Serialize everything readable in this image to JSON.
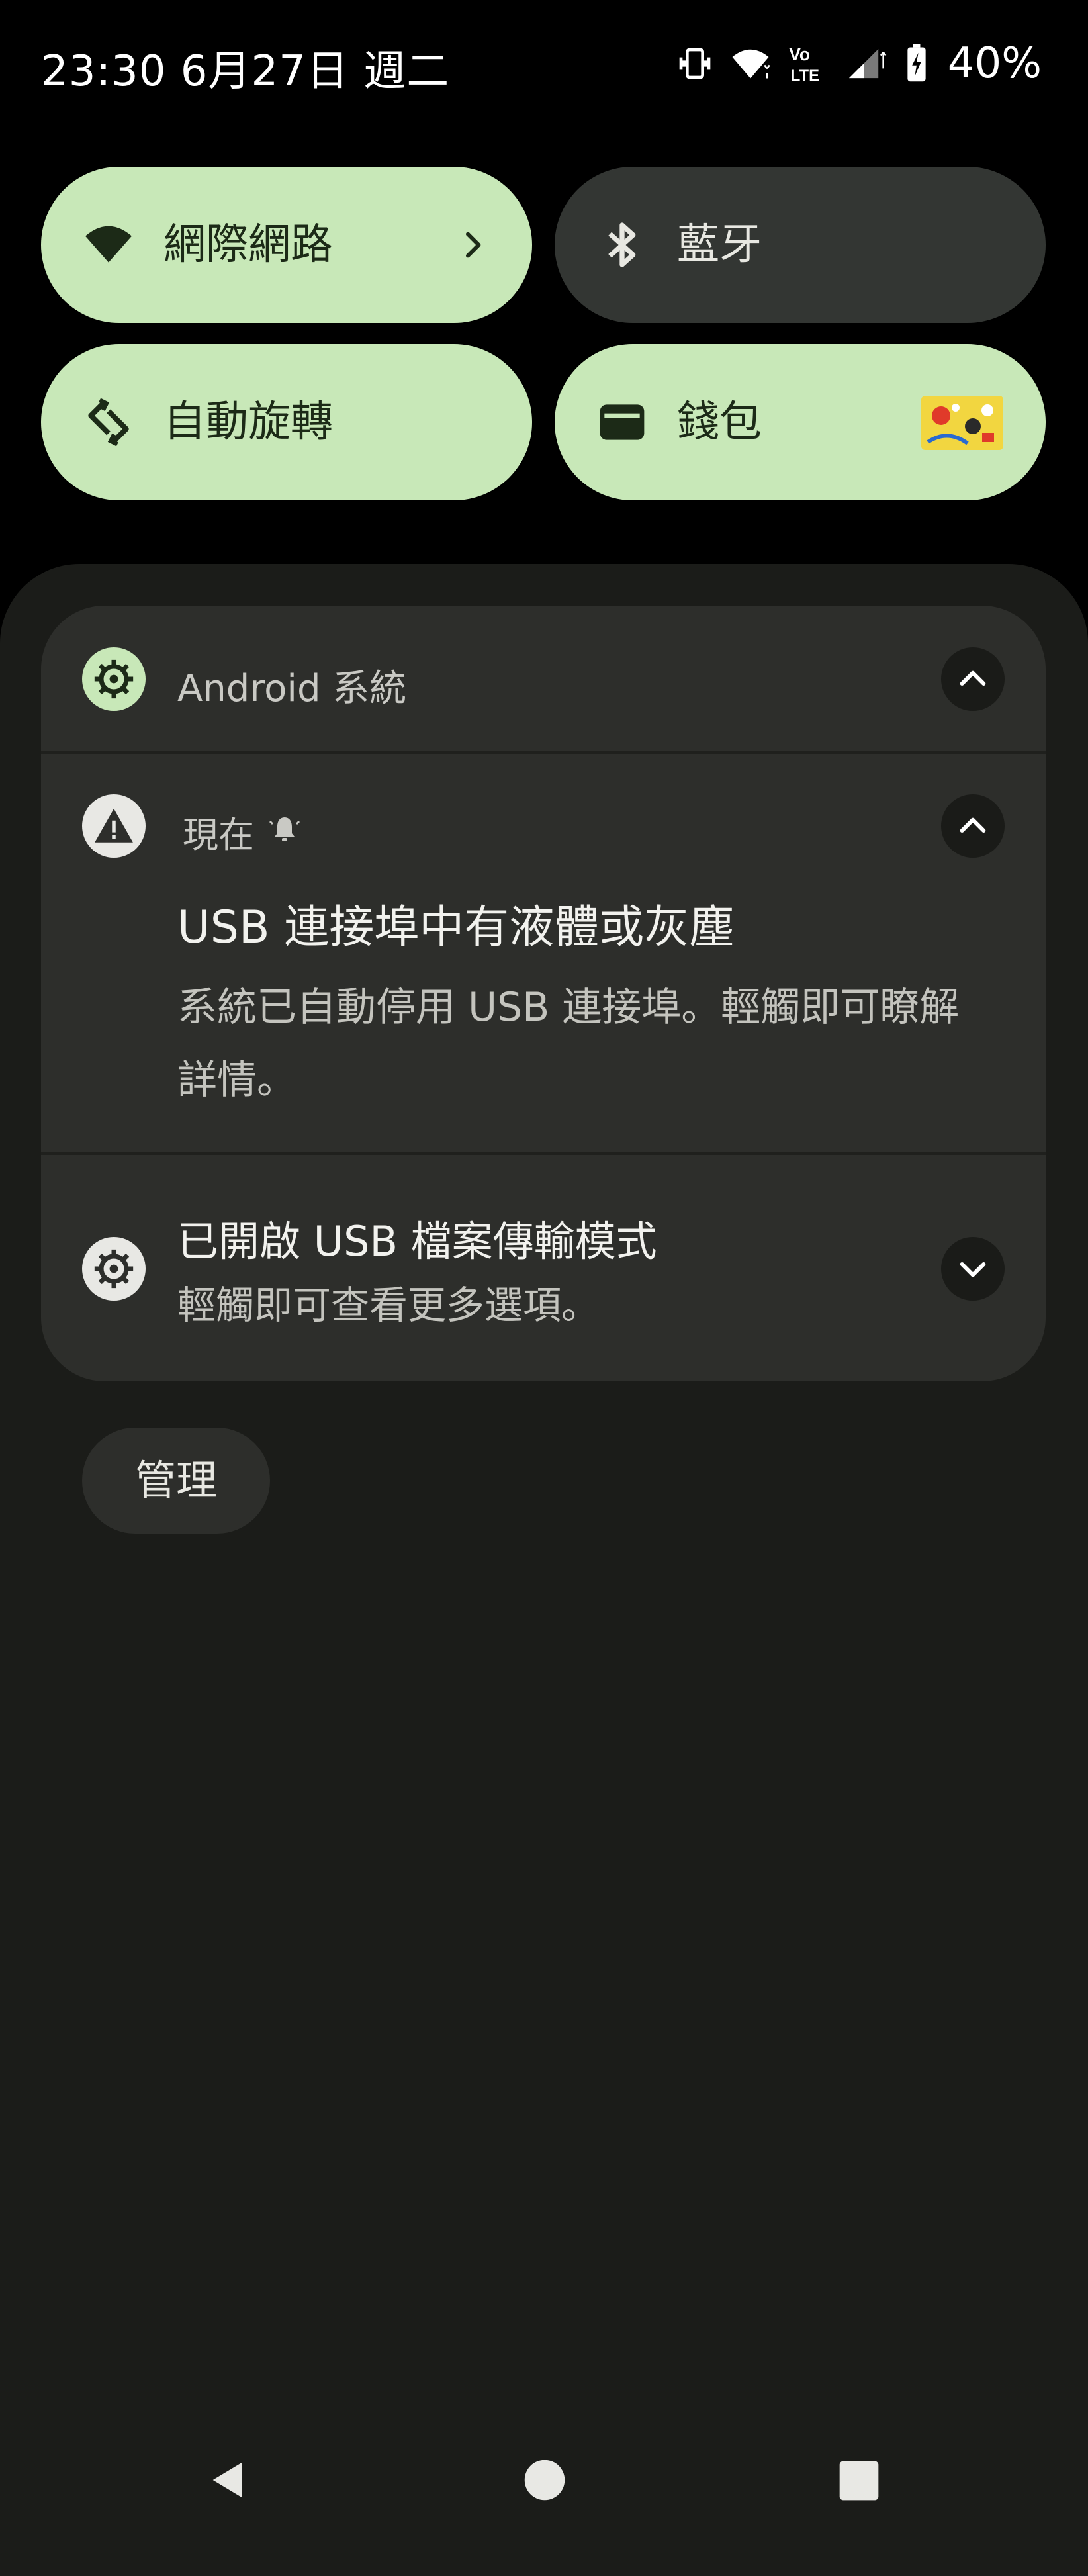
{
  "status_bar": {
    "time": "23:30 6月27日 週二",
    "battery": "40%",
    "icons": [
      "vibrate-icon",
      "wifi-icon",
      "volte-icon",
      "cell-signal-icon",
      "battery-charging-icon"
    ]
  },
  "quick_settings": {
    "tiles": [
      {
        "label": "網際網路",
        "icon": "wifi-icon",
        "state": "on",
        "has_chevron": true
      },
      {
        "label": "藍牙",
        "icon": "bluetooth-icon",
        "state": "off"
      },
      {
        "label": "自動旋轉",
        "icon": "auto-rotate-icon",
        "state": "on"
      },
      {
        "label": "錢包",
        "icon": "wallet-icon",
        "state": "on"
      }
    ]
  },
  "notifications": {
    "group_header": {
      "app_name": "Android 系統",
      "icon": "gear-icon"
    },
    "items": [
      {
        "time": "現在",
        "icon": "warning-icon",
        "title": "USB 連接埠中有液體或灰塵",
        "body_line1": "系統已自動停用 USB 連接埠。輕觸即可瞭解",
        "body_line2": "詳情。",
        "expanded": true
      },
      {
        "title": "已開啟 USB 檔案傳輸模式",
        "body": "輕觸即可查看更多選項。",
        "icon": "gear-icon",
        "expanded": false
      }
    ]
  },
  "manage_label": "管理",
  "navigation": [
    "back-icon",
    "home-icon",
    "recents-icon"
  ],
  "colors": {
    "tile_on": "#c8e8b8",
    "tile_off": "#333633",
    "shade_bg": "#1b1c19",
    "card_bg": "#2d2e2b"
  }
}
